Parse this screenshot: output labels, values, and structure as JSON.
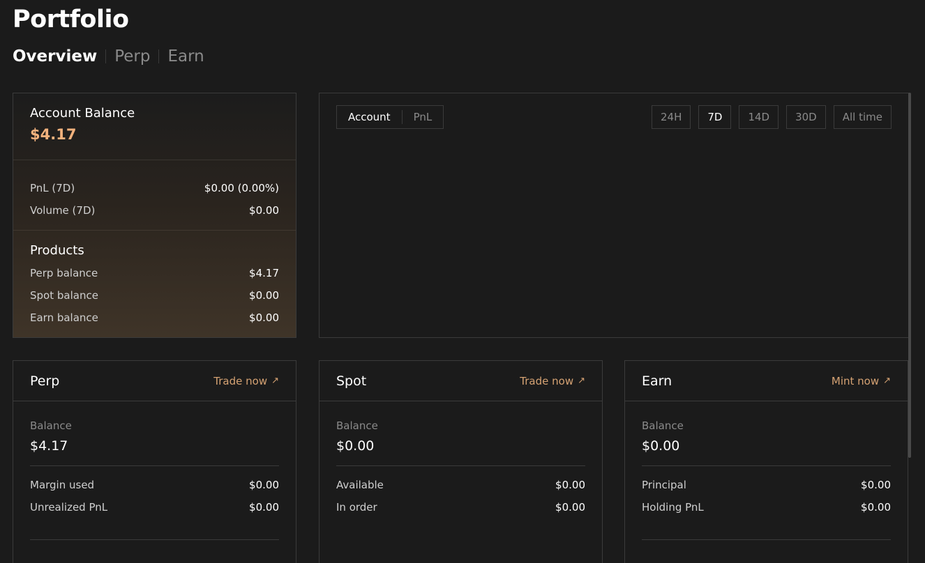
{
  "page": {
    "title": "Portfolio"
  },
  "tabs": [
    "Overview",
    "Perp",
    "Earn"
  ],
  "account": {
    "label": "Account Balance",
    "value": "$4.17",
    "stats": [
      {
        "label": "PnL (7D)",
        "value": "$0.00 (0.00%)"
      },
      {
        "label": "Volume (7D)",
        "value": "$0.00"
      }
    ],
    "products_title": "Products",
    "products": [
      {
        "label": "Perp balance",
        "value": "$4.17"
      },
      {
        "label": "Spot balance",
        "value": "$0.00"
      },
      {
        "label": "Earn balance",
        "value": "$0.00"
      }
    ]
  },
  "chart_panel": {
    "toggle": [
      "Account",
      "PnL"
    ],
    "active_toggle": "Account",
    "ranges": [
      "24H",
      "7D",
      "14D",
      "30D",
      "All time"
    ],
    "active_range": "7D"
  },
  "cards": {
    "perp": {
      "title": "Perp",
      "link": "Trade now",
      "balance_label": "Balance",
      "balance": "$4.17",
      "rows": [
        {
          "label": "Margin used",
          "value": "$0.00"
        },
        {
          "label": "Unrealized PnL",
          "value": "$0.00"
        }
      ]
    },
    "spot": {
      "title": "Spot",
      "link": "Trade now",
      "balance_label": "Balance",
      "balance": "$0.00",
      "rows": [
        {
          "label": "Available",
          "value": "$0.00"
        },
        {
          "label": "In order",
          "value": "$0.00"
        }
      ]
    },
    "earn": {
      "title": "Earn",
      "link": "Mint now",
      "balance_label": "Balance",
      "balance": "$0.00",
      "rows": [
        {
          "label": "Principal",
          "value": "$0.00"
        },
        {
          "label": "Holding PnL",
          "value": "$0.00"
        }
      ]
    }
  },
  "colors": {
    "background": "#1b1b1b",
    "accent": "#f3b27d",
    "link": "#d5a273",
    "border": "#3b3b3b"
  }
}
